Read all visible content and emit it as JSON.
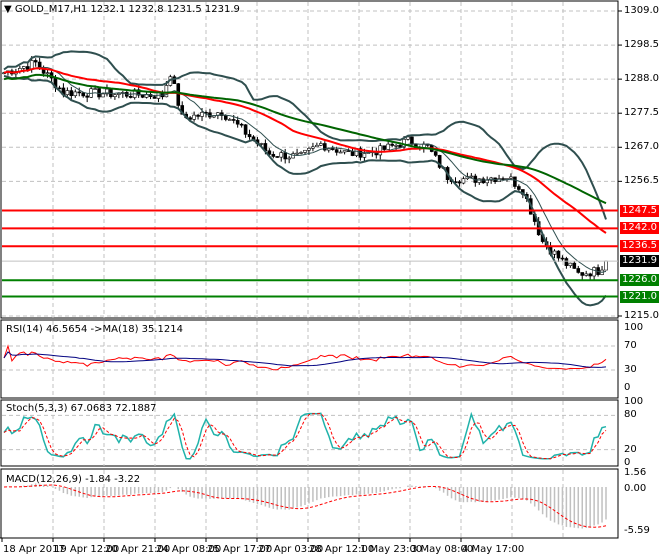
{
  "header": {
    "symbol": "GOLD_M17,H1",
    "ohlc": "1232.1 1232.8 1231.5 1231.9"
  },
  "price_axis": [
    "1309.0",
    "1298.5",
    "1288.0",
    "1277.5",
    "1267.0",
    "1256.5",
    "1215.0"
  ],
  "levels": [
    {
      "label": "1247.5",
      "price": 1247.5,
      "color": "#ff0000"
    },
    {
      "label": "1242.0",
      "price": 1242.0,
      "color": "#ff0000"
    },
    {
      "label": "1236.5",
      "price": 1236.5,
      "color": "#ff0000"
    },
    {
      "label": "1226.0",
      "price": 1226.0,
      "color": "#008000"
    },
    {
      "label": "1221.0",
      "price": 1221.0,
      "color": "#008000"
    }
  ],
  "current_price": {
    "label": "1231.9",
    "price": 1231.9,
    "color": "#000000"
  },
  "rsi": {
    "title": "RSI(14) 46.5654  ->MA(18) 35.1214",
    "axis": [
      "100",
      "70",
      "30",
      "0"
    ]
  },
  "stoch": {
    "title": "Stoch(5,3,3) 67.0683 72.1887",
    "axis": [
      "100",
      "80",
      "20",
      "0"
    ]
  },
  "macd": {
    "title": "MACD(12,26,9) -1.84 -3.22",
    "axis": [
      "1.56",
      "0.00",
      "-5.59"
    ]
  },
  "time_axis": [
    "18 Apr 2017",
    "19 Apr 12:00",
    "20 Apr 21:00",
    "24 Apr 08:00",
    "25 Apr 17:00",
    "27 Apr 03:00",
    "28 Apr 12:00",
    "1 May 23:00",
    "3 May 08:00",
    "4 May 17:00"
  ],
  "chart_data": {
    "type": "candlestick",
    "price_range": [
      1215.0,
      1309.0
    ],
    "close_keypoints": [
      [
        0,
        1290
      ],
      [
        8,
        1293
      ],
      [
        15,
        1284
      ],
      [
        40,
        1283
      ],
      [
        42,
        1290
      ],
      [
        45,
        1276
      ],
      [
        55,
        1278
      ],
      [
        67,
        1265
      ],
      [
        75,
        1264
      ],
      [
        80,
        1268
      ],
      [
        87,
        1265
      ],
      [
        95,
        1266
      ],
      [
        102,
        1269
      ],
      [
        107,
        1267
      ],
      [
        112,
        1258
      ],
      [
        117,
        1257
      ],
      [
        127,
        1258
      ],
      [
        131,
        1254
      ],
      [
        136,
        1238
      ],
      [
        140,
        1233
      ],
      [
        145,
        1228
      ],
      [
        150,
        1229
      ],
      [
        152,
        1231.9
      ]
    ],
    "colors": {
      "ma_slow": "#006400",
      "ma_mid": "#ff0000",
      "bands": "#2f4f4f",
      "rsi": "#ff0000",
      "rsi_ma": "#000080",
      "stoch_main": "#20b2aa",
      "stoch_signal": "#ff0000",
      "macd_hist": "#c0c0c0",
      "macd_signal": "#ff0000"
    }
  }
}
